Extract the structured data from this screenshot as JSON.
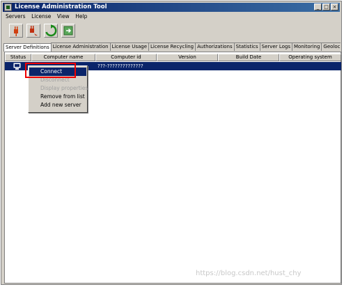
{
  "window": {
    "title": "License Administration Tool",
    "minimize": "_",
    "maximize": "□",
    "close": "×"
  },
  "menu": [
    "Servers",
    "License",
    "View",
    "Help"
  ],
  "toolbar": [
    "connect-plug-icon",
    "disconnect-plug-icon",
    "refresh-icon",
    "export-icon"
  ],
  "tabs": [
    "Server Definitions",
    "License Administration",
    "License Usage",
    "License Recycling",
    "Authorizations",
    "Statistics",
    "Server Logs",
    "Monitoring",
    "Geolocation"
  ],
  "table": {
    "columns": [
      "Status",
      "Computer name",
      "Computer id",
      "Version",
      "Build Date",
      "Operating system"
    ],
    "rows": [
      {
        "status_icon": "server-icon",
        "computer_id": "???-??????????????"
      }
    ]
  },
  "context_menu": {
    "items": [
      {
        "label": "Connect",
        "state": "highlighted"
      },
      {
        "label": "Disconnect",
        "state": "disabled"
      },
      {
        "label": "Display properties",
        "state": "disabled"
      },
      {
        "label": "Remove from list",
        "state": "enabled"
      },
      {
        "label": "Add new server",
        "state": "enabled"
      }
    ]
  },
  "watermark": "https://blog.csdn.net/hust_chy",
  "colors": {
    "selection": "#0a246a",
    "highlight_box": "#ee0000"
  }
}
